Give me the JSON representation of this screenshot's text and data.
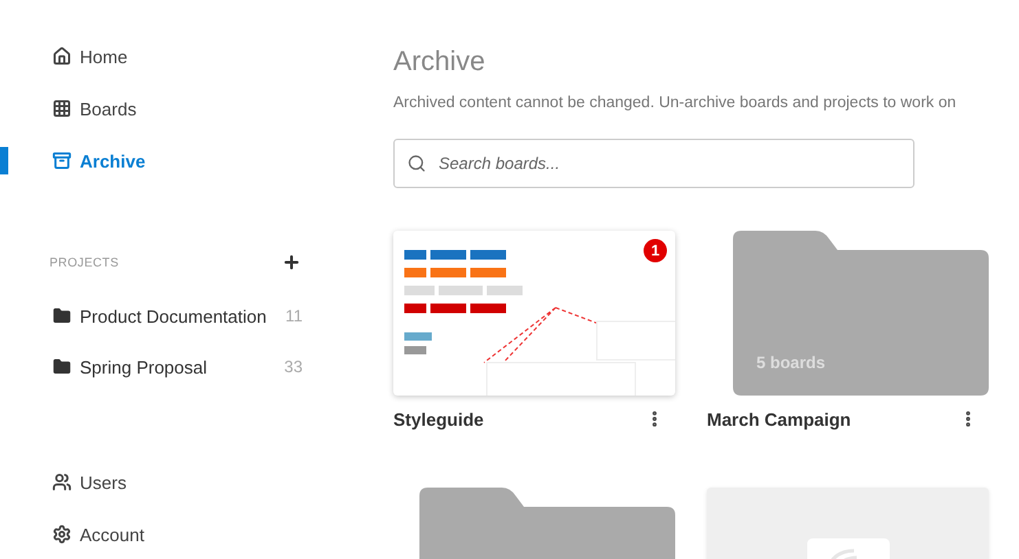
{
  "sidebar": {
    "nav": [
      {
        "label": "Home",
        "kind": "home",
        "selected": false
      },
      {
        "label": "Boards",
        "kind": "grid",
        "selected": false
      },
      {
        "label": "Archive",
        "kind": "archive",
        "selected": true
      }
    ],
    "projects_header": "PROJECTS",
    "projects": [
      {
        "name": "Product Documentation",
        "count": "11"
      },
      {
        "name": "Spring Proposal",
        "count": "33"
      }
    ],
    "bottom_nav": [
      {
        "label": "Users",
        "kind": "users"
      },
      {
        "label": "Account",
        "kind": "gear"
      }
    ]
  },
  "main": {
    "title": "Archive",
    "description": "Archived content cannot be changed. Un-archive boards and projects to work on",
    "search": {
      "placeholder": "Search boards..."
    },
    "items": [
      {
        "kind": "board",
        "title": "Styleguide",
        "badge": "1"
      },
      {
        "kind": "folder",
        "title": "March Campaign",
        "caption": "5 boards"
      },
      {
        "kind": "folder"
      },
      {
        "kind": "board_empty"
      }
    ]
  }
}
